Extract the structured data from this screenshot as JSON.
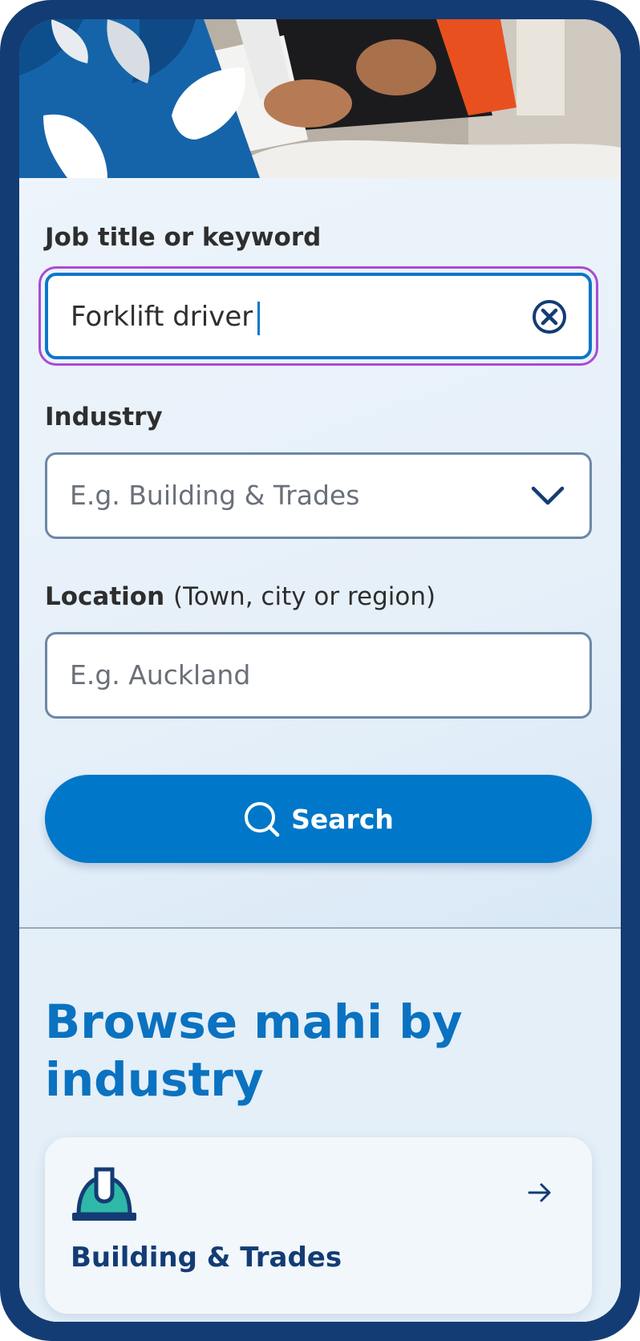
{
  "search_form": {
    "keyword_label": "Job title or keyword",
    "keyword_value": "Forklift driver",
    "industry_label": "Industry",
    "industry_placeholder": "E.g. Building & Trades",
    "location_label": "Location",
    "location_hint": "(Town, city or region)",
    "location_placeholder": "E.g. Auckland",
    "search_button_label": "Search"
  },
  "browse": {
    "title": "Browse mahi by industry",
    "cards": [
      {
        "label": "Building & Trades",
        "icon": "hard-hat-icon"
      }
    ]
  },
  "icons": {
    "clear": "close-circle-icon",
    "dropdown": "chevron-down-icon",
    "search": "search-icon",
    "arrow": "arrow-right-icon"
  },
  "colors": {
    "brand_dark": "#133c74",
    "accent_blue": "#0077c8",
    "focus_ring": "#a94bd4",
    "teal": "#2fb8a8"
  }
}
